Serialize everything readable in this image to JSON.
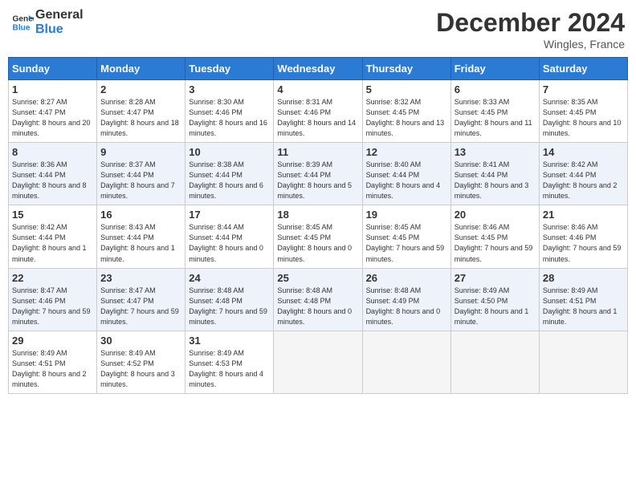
{
  "header": {
    "logo_line1": "General",
    "logo_line2": "Blue",
    "month": "December 2024",
    "location": "Wingles, France"
  },
  "days_of_week": [
    "Sunday",
    "Monday",
    "Tuesday",
    "Wednesday",
    "Thursday",
    "Friday",
    "Saturday"
  ],
  "weeks": [
    [
      {
        "day": "1",
        "sunrise": "8:27 AM",
        "sunset": "4:47 PM",
        "daylight": "8 hours and 20 minutes."
      },
      {
        "day": "2",
        "sunrise": "8:28 AM",
        "sunset": "4:47 PM",
        "daylight": "8 hours and 18 minutes."
      },
      {
        "day": "3",
        "sunrise": "8:30 AM",
        "sunset": "4:46 PM",
        "daylight": "8 hours and 16 minutes."
      },
      {
        "day": "4",
        "sunrise": "8:31 AM",
        "sunset": "4:46 PM",
        "daylight": "8 hours and 14 minutes."
      },
      {
        "day": "5",
        "sunrise": "8:32 AM",
        "sunset": "4:45 PM",
        "daylight": "8 hours and 13 minutes."
      },
      {
        "day": "6",
        "sunrise": "8:33 AM",
        "sunset": "4:45 PM",
        "daylight": "8 hours and 11 minutes."
      },
      {
        "day": "7",
        "sunrise": "8:35 AM",
        "sunset": "4:45 PM",
        "daylight": "8 hours and 10 minutes."
      }
    ],
    [
      {
        "day": "8",
        "sunrise": "8:36 AM",
        "sunset": "4:44 PM",
        "daylight": "8 hours and 8 minutes."
      },
      {
        "day": "9",
        "sunrise": "8:37 AM",
        "sunset": "4:44 PM",
        "daylight": "8 hours and 7 minutes."
      },
      {
        "day": "10",
        "sunrise": "8:38 AM",
        "sunset": "4:44 PM",
        "daylight": "8 hours and 6 minutes."
      },
      {
        "day": "11",
        "sunrise": "8:39 AM",
        "sunset": "4:44 PM",
        "daylight": "8 hours and 5 minutes."
      },
      {
        "day": "12",
        "sunrise": "8:40 AM",
        "sunset": "4:44 PM",
        "daylight": "8 hours and 4 minutes."
      },
      {
        "day": "13",
        "sunrise": "8:41 AM",
        "sunset": "4:44 PM",
        "daylight": "8 hours and 3 minutes."
      },
      {
        "day": "14",
        "sunrise": "8:42 AM",
        "sunset": "4:44 PM",
        "daylight": "8 hours and 2 minutes."
      }
    ],
    [
      {
        "day": "15",
        "sunrise": "8:42 AM",
        "sunset": "4:44 PM",
        "daylight": "8 hours and 1 minute."
      },
      {
        "day": "16",
        "sunrise": "8:43 AM",
        "sunset": "4:44 PM",
        "daylight": "8 hours and 1 minute."
      },
      {
        "day": "17",
        "sunrise": "8:44 AM",
        "sunset": "4:44 PM",
        "daylight": "8 hours and 0 minutes."
      },
      {
        "day": "18",
        "sunrise": "8:45 AM",
        "sunset": "4:45 PM",
        "daylight": "8 hours and 0 minutes."
      },
      {
        "day": "19",
        "sunrise": "8:45 AM",
        "sunset": "4:45 PM",
        "daylight": "7 hours and 59 minutes."
      },
      {
        "day": "20",
        "sunrise": "8:46 AM",
        "sunset": "4:45 PM",
        "daylight": "7 hours and 59 minutes."
      },
      {
        "day": "21",
        "sunrise": "8:46 AM",
        "sunset": "4:46 PM",
        "daylight": "7 hours and 59 minutes."
      }
    ],
    [
      {
        "day": "22",
        "sunrise": "8:47 AM",
        "sunset": "4:46 PM",
        "daylight": "7 hours and 59 minutes."
      },
      {
        "day": "23",
        "sunrise": "8:47 AM",
        "sunset": "4:47 PM",
        "daylight": "7 hours and 59 minutes."
      },
      {
        "day": "24",
        "sunrise": "8:48 AM",
        "sunset": "4:48 PM",
        "daylight": "7 hours and 59 minutes."
      },
      {
        "day": "25",
        "sunrise": "8:48 AM",
        "sunset": "4:48 PM",
        "daylight": "8 hours and 0 minutes."
      },
      {
        "day": "26",
        "sunrise": "8:48 AM",
        "sunset": "4:49 PM",
        "daylight": "8 hours and 0 minutes."
      },
      {
        "day": "27",
        "sunrise": "8:49 AM",
        "sunset": "4:50 PM",
        "daylight": "8 hours and 1 minute."
      },
      {
        "day": "28",
        "sunrise": "8:49 AM",
        "sunset": "4:51 PM",
        "daylight": "8 hours and 1 minute."
      }
    ],
    [
      {
        "day": "29",
        "sunrise": "8:49 AM",
        "sunset": "4:51 PM",
        "daylight": "8 hours and 2 minutes."
      },
      {
        "day": "30",
        "sunrise": "8:49 AM",
        "sunset": "4:52 PM",
        "daylight": "8 hours and 3 minutes."
      },
      {
        "day": "31",
        "sunrise": "8:49 AM",
        "sunset": "4:53 PM",
        "daylight": "8 hours and 4 minutes."
      },
      null,
      null,
      null,
      null
    ]
  ]
}
